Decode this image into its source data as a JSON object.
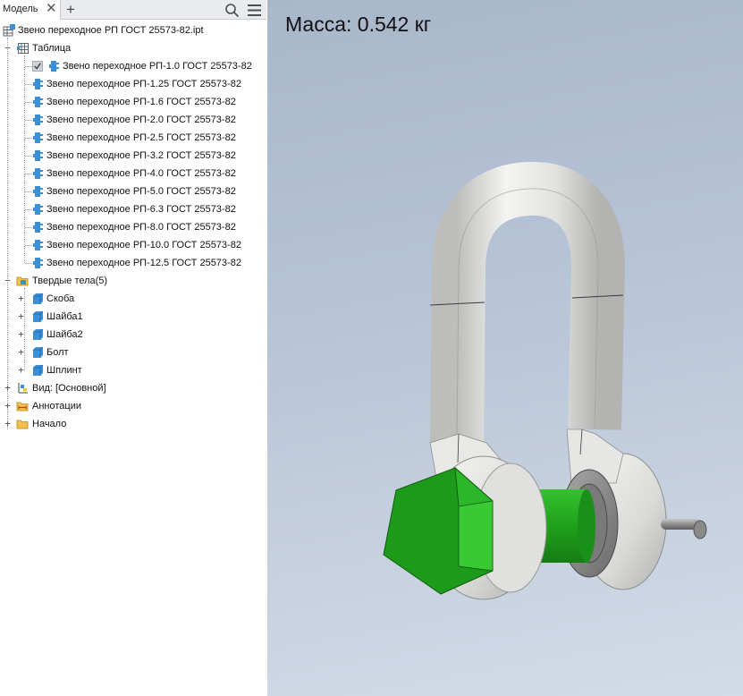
{
  "browser": {
    "tab_label": "Модель",
    "tab_close": "✕",
    "tab_add": "+",
    "root": "Звено переходное РП ГОСТ 25573-82.ipt",
    "table": {
      "label": "Таблица",
      "rows": [
        "Звено переходное РП-1.0 ГОСТ 25573-82",
        "Звено переходное РП-1.25 ГОСТ 25573-82",
        "Звено переходное РП-1.6 ГОСТ 25573-82",
        "Звено переходное РП-2.0 ГОСТ 25573-82",
        "Звено переходное РП-2.5 ГОСТ 25573-82",
        "Звено переходное РП-3.2 ГОСТ 25573-82",
        "Звено переходное РП-4.0 ГОСТ 25573-82",
        "Звено переходное РП-5.0 ГОСТ 25573-82",
        "Звено переходное РП-6.3 ГОСТ 25573-82",
        "Звено переходное РП-8.0 ГОСТ 25573-82",
        "Звено переходное РП-10.0 ГОСТ 25573-82",
        "Звено переходное РП-12.5 ГОСТ 25573-82"
      ],
      "active_row": "Звено переходное РП-1.0 ГОСТ 25573-82"
    },
    "solids": {
      "label": "Твердые тела(5)",
      "items": [
        "Скоба",
        "Шайба1",
        "Шайба2",
        "Болт",
        "Шплинт"
      ]
    },
    "view": "Вид: [Основной]",
    "annotations": "Аннотации",
    "origin": "Начало"
  },
  "viewport": {
    "mass_label": "Масса:",
    "mass_value": "0.542 кг"
  },
  "colors": {
    "shackle": "#e4e4e2",
    "bolt_green": "#22a51f",
    "washer": "#8c8c8c",
    "pin": "#9a9a9a",
    "icon_blue": "#3a8fd6",
    "folder": "#f2c14e"
  },
  "icons": {
    "search": "search-icon",
    "menu": "hamburger-menu-icon",
    "part": "part-file-icon",
    "table": "table-icon",
    "member": "table-member-icon",
    "solids": "solid-bodies-folder-icon",
    "solid": "solid-body-icon",
    "view": "view-representation-icon",
    "annotation": "annotation-icon",
    "origin": "origin-folder-icon"
  }
}
